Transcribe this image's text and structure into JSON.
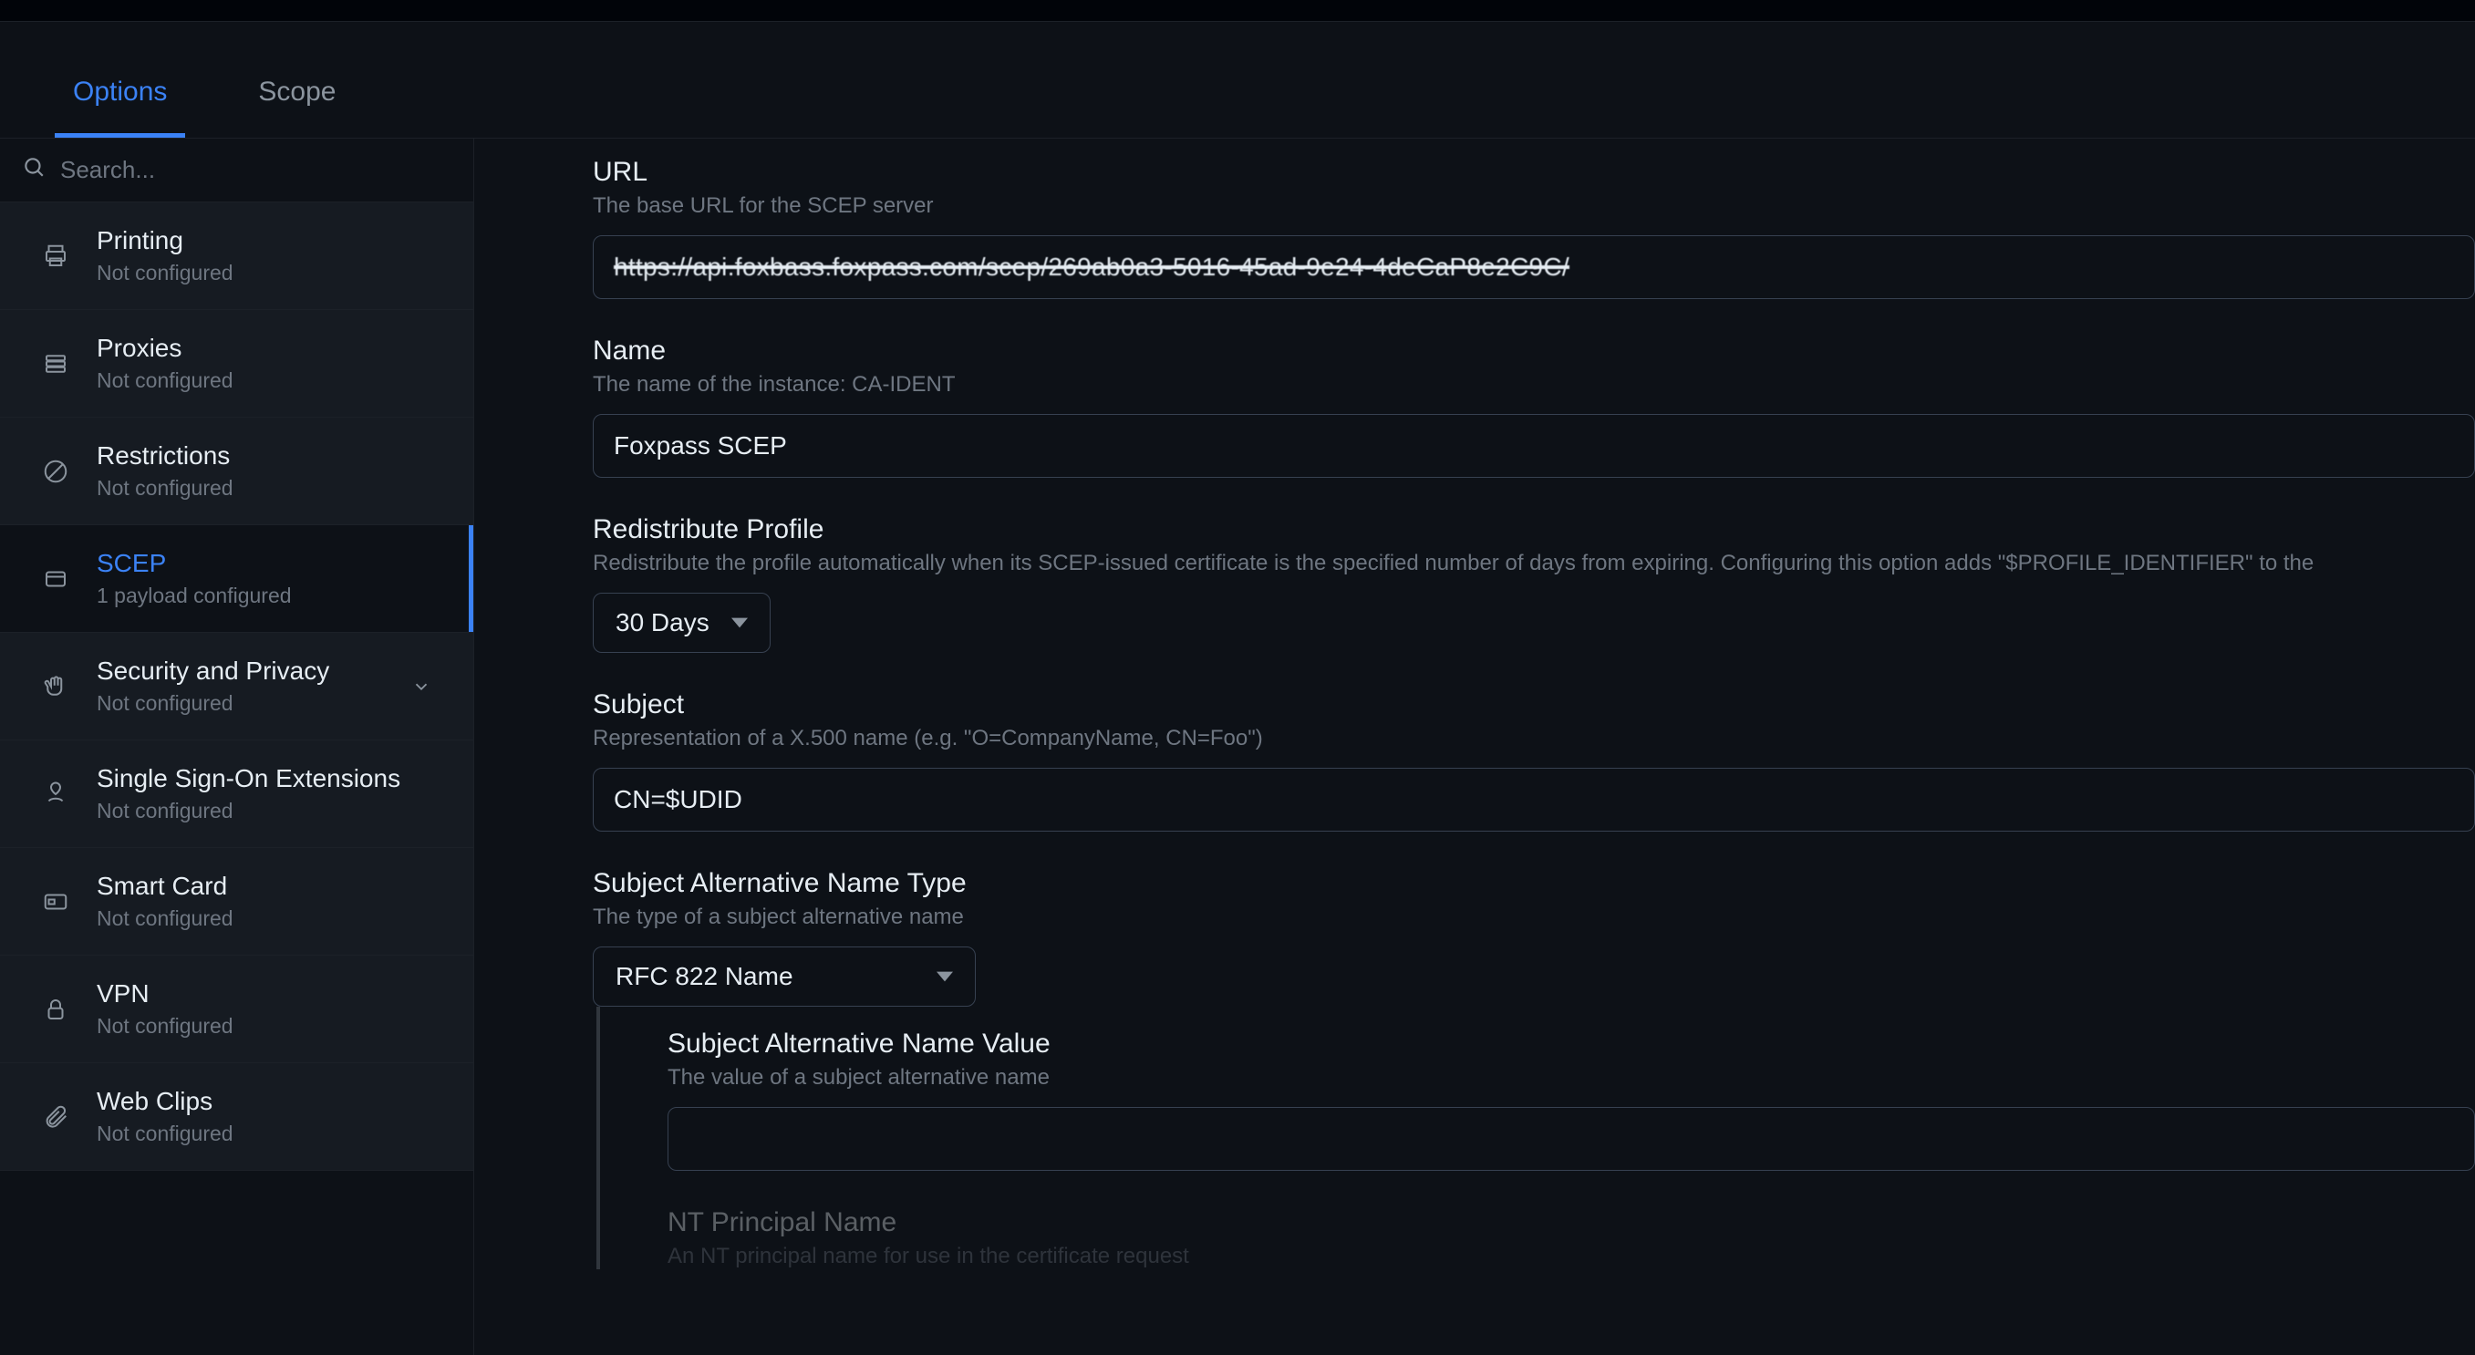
{
  "tabs": {
    "options": "Options",
    "scope": "Scope"
  },
  "search": {
    "placeholder": "Search..."
  },
  "sidebar": {
    "printing": {
      "label": "Printing",
      "sub": "Not configured"
    },
    "proxies": {
      "label": "Proxies",
      "sub": "Not configured"
    },
    "restrictions": {
      "label": "Restrictions",
      "sub": "Not configured"
    },
    "scep": {
      "label": "SCEP",
      "sub": "1 payload configured"
    },
    "security": {
      "label": "Security and Privacy",
      "sub": "Not configured"
    },
    "sso": {
      "label": "Single Sign-On Extensions",
      "sub": "Not configured"
    },
    "smartcard": {
      "label": "Smart Card",
      "sub": "Not configured"
    },
    "vpn": {
      "label": "VPN",
      "sub": "Not configured"
    },
    "webclips": {
      "label": "Web Clips",
      "sub": "Not configured"
    }
  },
  "form": {
    "url": {
      "label": "URL",
      "desc": "The base URL for the SCEP server",
      "value": "https://api.foxbass.foxpass.com/scep/269ab0a3-5016-45ad-9e24-4deCaP8e2C9C/"
    },
    "name": {
      "label": "Name",
      "desc": "The name of the instance: CA-IDENT",
      "value": "Foxpass SCEP"
    },
    "redist": {
      "label": "Redistribute Profile",
      "desc": "Redistribute the profile automatically when its SCEP-issued certificate is the specified number of days from expiring. Configuring this option adds \"$PROFILE_IDENTIFIER\" to the",
      "value": "30 Days"
    },
    "subject": {
      "label": "Subject",
      "desc": "Representation of a X.500 name (e.g. \"O=CompanyName, CN=Foo\")",
      "value": "CN=$UDID"
    },
    "san_type": {
      "label": "Subject Alternative Name Type",
      "desc": "The type of a subject alternative name",
      "value": "RFC 822 Name"
    },
    "san_value": {
      "label": "Subject Alternative Name Value",
      "desc": "The value of a subject alternative name",
      "value": ""
    },
    "nt_principal": {
      "label": "NT Principal Name",
      "desc": "An NT principal name for use in the certificate request"
    }
  }
}
